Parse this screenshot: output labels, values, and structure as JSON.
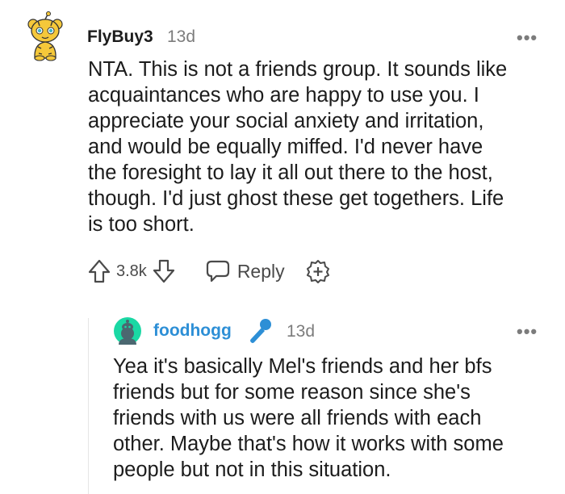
{
  "top_comment": {
    "username": "FlyBuy3",
    "timestamp": "13d",
    "more": "•••",
    "text_lines": [
      "NTA. This is not a friends group. It sounds like",
      "acquaintances who are happy to use you. I",
      "appreciate your social anxiety and irritation,",
      "and would be equally miffed. I'd never have",
      "the foresight to lay it all out there to the host,",
      "though. I'd just ghost these get togethers. Life",
      "is too short."
    ],
    "vote_count": "3.8k",
    "reply_label": "Reply",
    "icons": {
      "upvote": "arrow-up-icon",
      "downvote": "arrow-down-icon",
      "reply": "speech-bubble-icon",
      "award": "award-plus-icon",
      "more": "more-dots-icon",
      "avatar": "snoo-avatar-icon"
    }
  },
  "reply_comment": {
    "username": "foodhogg",
    "badge_icon": "microphone-icon",
    "timestamp": "13d",
    "more": "•••",
    "text_lines": [
      "Yea it's basically Mel's friends and her bfs",
      "friends but for some reason since she's",
      "friends with us were all friends with each",
      "other. Maybe that's how it works with some",
      "people but not in this situation."
    ]
  },
  "colors": {
    "username_reply": "#2d8fd6",
    "mic_badge": "#2d8fd6",
    "avatar_reply_bg": "#1ad8a4",
    "meta_gray": "#7c7c7c",
    "text": "#1c1c1c",
    "avatar_top": "#f5c83a"
  }
}
